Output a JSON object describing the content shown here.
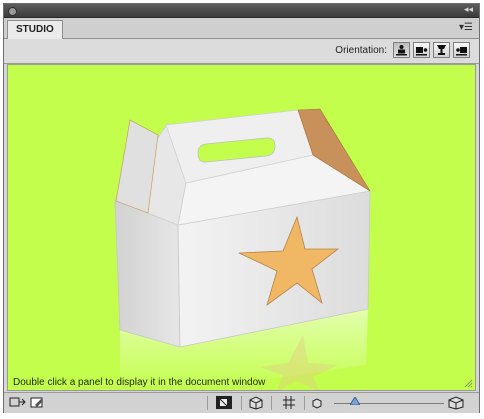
{
  "panel": {
    "tab_label": "STUDIO",
    "collapse_glyph": "◂◂",
    "menu_glyph": "▾☰"
  },
  "options": {
    "orientation_label": "Orientation:",
    "orientation_buttons": [
      "portrait-figure-icon",
      "side-view-icon",
      "trophy-icon",
      "landscape-view-icon"
    ]
  },
  "viewport": {
    "background": "#c2fe4b",
    "hint": "Double click a panel to display it in the document window"
  },
  "statusbar": {
    "icons": [
      "fit-window-icon",
      "edit-icon",
      "render-mode-icon",
      "cube-icon",
      "grid-icon",
      "small-cube-icon",
      "zoom-slider",
      "large-cube-icon"
    ]
  }
}
